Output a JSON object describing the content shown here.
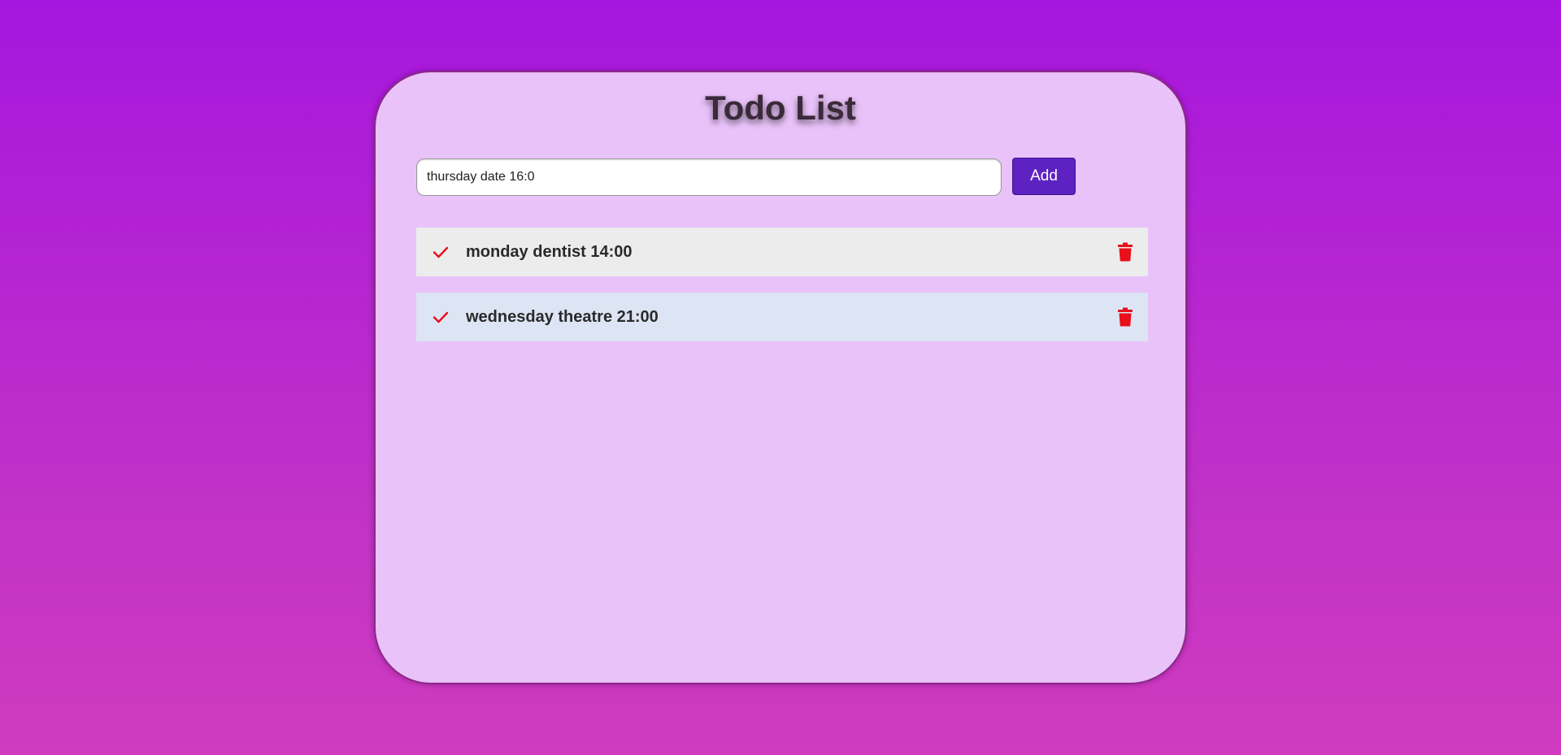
{
  "app": {
    "title": "Todo List"
  },
  "input": {
    "value": "thursday date 16:0",
    "placeholder": ""
  },
  "add_button": {
    "label": "Add"
  },
  "todos": [
    {
      "text": "monday dentist 14:00"
    },
    {
      "text": "wednesday theatre 21:00"
    }
  ],
  "icons": {
    "check": "check-icon",
    "delete": "trash-icon"
  },
  "colors": {
    "accent": "#5e22c2",
    "icon_red": "#e8101a",
    "card_bg": "#e9c2f9"
  }
}
